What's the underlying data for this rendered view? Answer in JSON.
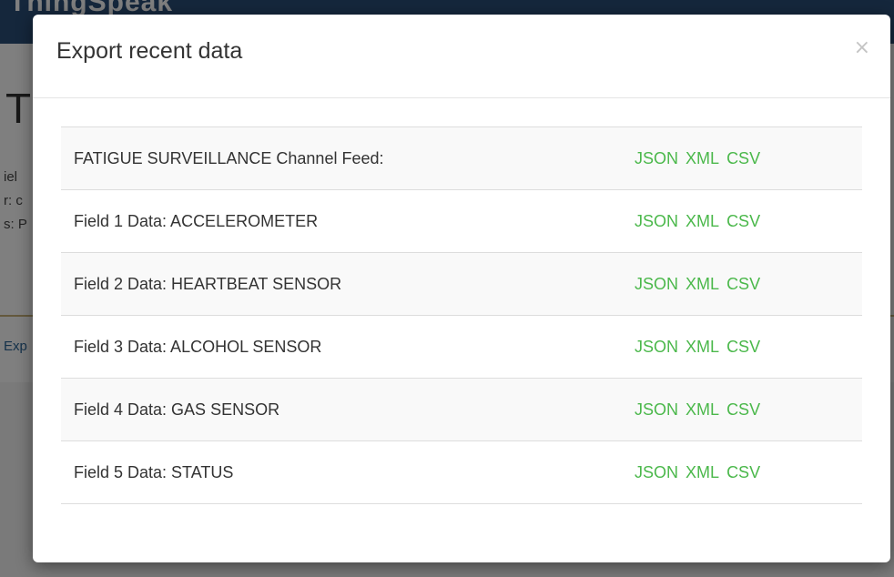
{
  "background": {
    "brand": "ThingSpeak",
    "title": "T",
    "meta_lines": [
      "iel",
      "r: c",
      "s: P"
    ],
    "export_link": "Exp"
  },
  "modal": {
    "title": "Export recent data",
    "close_label": "×",
    "rows": [
      {
        "label": "FATIGUE SURVEILLANCE Channel Feed:",
        "formats": [
          "JSON",
          "XML",
          "CSV"
        ]
      },
      {
        "label": "Field 1 Data: ACCELEROMETER",
        "formats": [
          "JSON",
          "XML",
          "CSV"
        ]
      },
      {
        "label": "Field 2 Data: HEARTBEAT SENSOR",
        "formats": [
          "JSON",
          "XML",
          "CSV"
        ]
      },
      {
        "label": "Field 3 Data: ALCOHOL SENSOR",
        "formats": [
          "JSON",
          "XML",
          "CSV"
        ]
      },
      {
        "label": "Field 4 Data: GAS SENSOR",
        "formats": [
          "JSON",
          "XML",
          "CSV"
        ]
      },
      {
        "label": "Field 5 Data: STATUS",
        "formats": [
          "JSON",
          "XML",
          "CSV"
        ]
      }
    ]
  },
  "colors": {
    "header_bg": "#2a4f79",
    "link_green": "#4bb84b",
    "text": "#333333",
    "stripe": "#f9f9f9",
    "border": "#dddddd"
  }
}
